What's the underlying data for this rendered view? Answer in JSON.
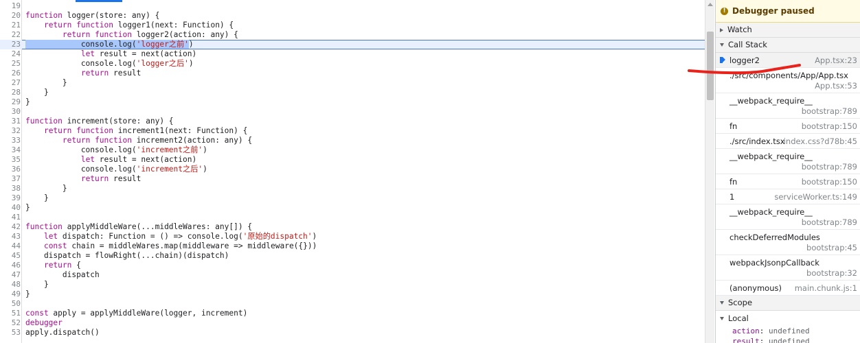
{
  "editor": {
    "lines": [
      {
        "no": "19",
        "segments": [
          {
            "t": ""
          }
        ]
      },
      {
        "no": "20",
        "segments": [
          {
            "t": "function",
            "c": "kw"
          },
          {
            "t": " logger(store: any) {"
          }
        ]
      },
      {
        "no": "21",
        "segments": [
          {
            "t": "    "
          },
          {
            "t": "return",
            "c": "kw"
          },
          {
            "t": " "
          },
          {
            "t": "function",
            "c": "kw"
          },
          {
            "t": " logger1(next: Function) {"
          }
        ]
      },
      {
        "no": "22",
        "segments": [
          {
            "t": "        "
          },
          {
            "t": "return",
            "c": "kw"
          },
          {
            "t": " "
          },
          {
            "t": "function",
            "c": "kw"
          },
          {
            "t": " logger2(action: any) {"
          }
        ]
      },
      {
        "no": "23",
        "current": true,
        "segments": [
          {
            "t": "            console.log(",
            "c": "hl"
          },
          {
            "t": "'logger之前'",
            "c": "str hl"
          },
          {
            "t": ")"
          }
        ]
      },
      {
        "no": "24",
        "segments": [
          {
            "t": "            "
          },
          {
            "t": "let",
            "c": "kw"
          },
          {
            "t": " result = next(action)"
          }
        ]
      },
      {
        "no": "25",
        "segments": [
          {
            "t": "            console.log("
          },
          {
            "t": "'logger之后'",
            "c": "str"
          },
          {
            "t": ")"
          }
        ]
      },
      {
        "no": "26",
        "segments": [
          {
            "t": "            "
          },
          {
            "t": "return",
            "c": "kw"
          },
          {
            "t": " result"
          }
        ]
      },
      {
        "no": "27",
        "segments": [
          {
            "t": "        }"
          }
        ]
      },
      {
        "no": "28",
        "segments": [
          {
            "t": "    }"
          }
        ]
      },
      {
        "no": "29",
        "segments": [
          {
            "t": "}"
          }
        ]
      },
      {
        "no": "30",
        "segments": [
          {
            "t": ""
          }
        ]
      },
      {
        "no": "31",
        "segments": [
          {
            "t": "function",
            "c": "kw"
          },
          {
            "t": " increment(store: any) {"
          }
        ]
      },
      {
        "no": "32",
        "segments": [
          {
            "t": "    "
          },
          {
            "t": "return",
            "c": "kw"
          },
          {
            "t": " "
          },
          {
            "t": "function",
            "c": "kw"
          },
          {
            "t": " increment1(next: Function) {"
          }
        ]
      },
      {
        "no": "33",
        "segments": [
          {
            "t": "        "
          },
          {
            "t": "return",
            "c": "kw"
          },
          {
            "t": " "
          },
          {
            "t": "function",
            "c": "kw"
          },
          {
            "t": " increment2(action: any) {"
          }
        ]
      },
      {
        "no": "34",
        "segments": [
          {
            "t": "            console.log("
          },
          {
            "t": "'increment之前'",
            "c": "str"
          },
          {
            "t": ")"
          }
        ]
      },
      {
        "no": "35",
        "segments": [
          {
            "t": "            "
          },
          {
            "t": "let",
            "c": "kw"
          },
          {
            "t": " result = next(action)"
          }
        ]
      },
      {
        "no": "36",
        "segments": [
          {
            "t": "            console.log("
          },
          {
            "t": "'increment之后'",
            "c": "str"
          },
          {
            "t": ")"
          }
        ]
      },
      {
        "no": "37",
        "segments": [
          {
            "t": "            "
          },
          {
            "t": "return",
            "c": "kw"
          },
          {
            "t": " result"
          }
        ]
      },
      {
        "no": "38",
        "segments": [
          {
            "t": "        }"
          }
        ]
      },
      {
        "no": "39",
        "segments": [
          {
            "t": "    }"
          }
        ]
      },
      {
        "no": "40",
        "segments": [
          {
            "t": "}"
          }
        ]
      },
      {
        "no": "41",
        "segments": [
          {
            "t": ""
          }
        ]
      },
      {
        "no": "42",
        "segments": [
          {
            "t": "function",
            "c": "kw"
          },
          {
            "t": " applyMiddleWare(...middleWares: any[]) {"
          }
        ]
      },
      {
        "no": "43",
        "segments": [
          {
            "t": "    "
          },
          {
            "t": "let",
            "c": "kw"
          },
          {
            "t": " dispatch: Function = () => console.log("
          },
          {
            "t": "'原始的dispatch'",
            "c": "str"
          },
          {
            "t": ")"
          }
        ]
      },
      {
        "no": "44",
        "segments": [
          {
            "t": "    "
          },
          {
            "t": "const",
            "c": "kw"
          },
          {
            "t": " chain = middleWares.map(middleware => middleware({}))"
          }
        ]
      },
      {
        "no": "45",
        "segments": [
          {
            "t": "    dispatch = flowRight(...chain)(dispatch)"
          }
        ]
      },
      {
        "no": "46",
        "segments": [
          {
            "t": "    "
          },
          {
            "t": "return",
            "c": "kw"
          },
          {
            "t": " {"
          }
        ]
      },
      {
        "no": "47",
        "segments": [
          {
            "t": "        dispatch"
          }
        ]
      },
      {
        "no": "48",
        "segments": [
          {
            "t": "    }"
          }
        ]
      },
      {
        "no": "49",
        "segments": [
          {
            "t": "}"
          }
        ]
      },
      {
        "no": "50",
        "segments": [
          {
            "t": ""
          }
        ]
      },
      {
        "no": "51",
        "segments": [
          {
            "t": "const",
            "c": "kw"
          },
          {
            "t": " apply = applyMiddleWare(logger, increment)"
          }
        ]
      },
      {
        "no": "52",
        "segments": [
          {
            "t": "debugger",
            "c": "kw"
          }
        ]
      },
      {
        "no": "53",
        "segments": [
          {
            "t": "apply.dispatch()"
          }
        ]
      }
    ]
  },
  "sidebar": {
    "paused_icon": "info-icon",
    "paused_text": "Debugger paused",
    "watch_label": "Watch",
    "call_stack_label": "Call Stack",
    "frames": [
      {
        "name": "logger2",
        "loc": "App.tsx:23",
        "selected": true,
        "double": false
      },
      {
        "name": "./src/components/App/App.tsx",
        "loc": "App.tsx:53",
        "double": true
      },
      {
        "name": "__webpack_require__",
        "loc": "bootstrap:789",
        "double": true
      },
      {
        "name": "fn",
        "loc": "bootstrap:150",
        "double": false
      },
      {
        "name": "./src/index.tsx",
        "loc": "index.css?d78b:45",
        "double": false
      },
      {
        "name": "__webpack_require__",
        "loc": "bootstrap:789",
        "double": true
      },
      {
        "name": "fn",
        "loc": "bootstrap:150",
        "double": false
      },
      {
        "name": "1",
        "loc": "serviceWorker.ts:149",
        "double": false
      },
      {
        "name": "__webpack_require__",
        "loc": "bootstrap:789",
        "double": true
      },
      {
        "name": "checkDeferredModules",
        "loc": "bootstrap:45",
        "double": true
      },
      {
        "name": "webpackJsonpCallback",
        "loc": "bootstrap:32",
        "double": true
      },
      {
        "name": "(anonymous)",
        "loc": "main.chunk.js:1",
        "double": false
      }
    ],
    "scope_label": "Scope",
    "local_label": "Local",
    "locals": [
      {
        "key": "action",
        "value": "undefined"
      },
      {
        "key": "result",
        "value": "undefined"
      }
    ]
  },
  "annotation_color": "#e8231b",
  "colors": {
    "keyword": "#aa0d91",
    "string": "#c41a16",
    "accent": "#1a73e8"
  }
}
